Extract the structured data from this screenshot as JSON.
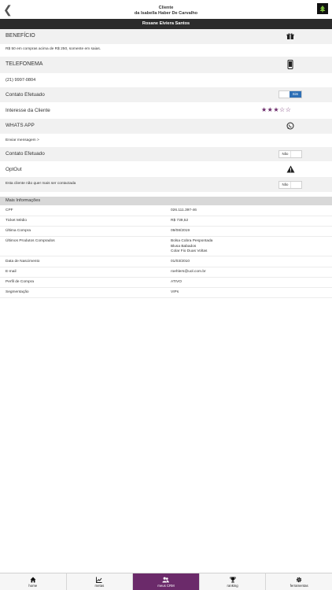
{
  "header": {
    "title": "Cliente",
    "subtitle": "da Isabella Haber De Carvalho",
    "customer_name": "Rosane Elviera Santos"
  },
  "beneficio": {
    "label": "BENEFÍCIO",
    "text": "R$ 50 em compras acima de R$ 250, somente em saias."
  },
  "telefonema": {
    "label": "TELEFONEMA",
    "phone": "(21) 9997-0804",
    "contato_label": "Contato Efetuado",
    "toggle_value": "Sim"
  },
  "interesse": {
    "label": "Interesse da Cliente",
    "rating": 3,
    "max": 5,
    "stars_filled": "★★★",
    "stars_empty": "☆☆"
  },
  "whatsapp": {
    "label": "WHATS APP",
    "send_label": "Enviar mensagem >",
    "contato_label": "Contato Efetuado",
    "toggle_value": "Não"
  },
  "optout": {
    "label": "OptOut",
    "text": "Esta cliente não quer mais ser contactada",
    "toggle_value": "Não"
  },
  "mais": {
    "title": "Mais Informações",
    "rows": [
      {
        "key": "CPF",
        "value": "026.111.397-46"
      },
      {
        "key": "Ticket Médio",
        "value": "R$ 739,52"
      },
      {
        "key": "Última Compra",
        "value": "09/08/2019"
      },
      {
        "key": "Últimos Produtos Comprados",
        "value": "Bolsa Cobra Pespontada\nBlusa Babados\nColar Fio Duas Voltas"
      },
      {
        "key": "Data de Nascimento",
        "value": "01/03/2010"
      },
      {
        "key": "E-mail",
        "value": "roehlers@uol.com.br"
      },
      {
        "key": "Perfil de Compra",
        "value": "ATIVO"
      },
      {
        "key": "Segmentação",
        "value": "VIPs"
      }
    ]
  },
  "tabs": [
    {
      "label": "home",
      "icon": "home-icon"
    },
    {
      "label": "metas",
      "icon": "chart-icon"
    },
    {
      "label": "meus CRM",
      "icon": "users-icon",
      "active": true
    },
    {
      "label": "ranking",
      "icon": "trophy-icon"
    },
    {
      "label": "ferramentas",
      "icon": "gear-icon"
    }
  ],
  "colors": {
    "accent": "#6b2a6a",
    "toggle_on": "#2e6fb5",
    "name_bar": "#2c2c2c"
  }
}
